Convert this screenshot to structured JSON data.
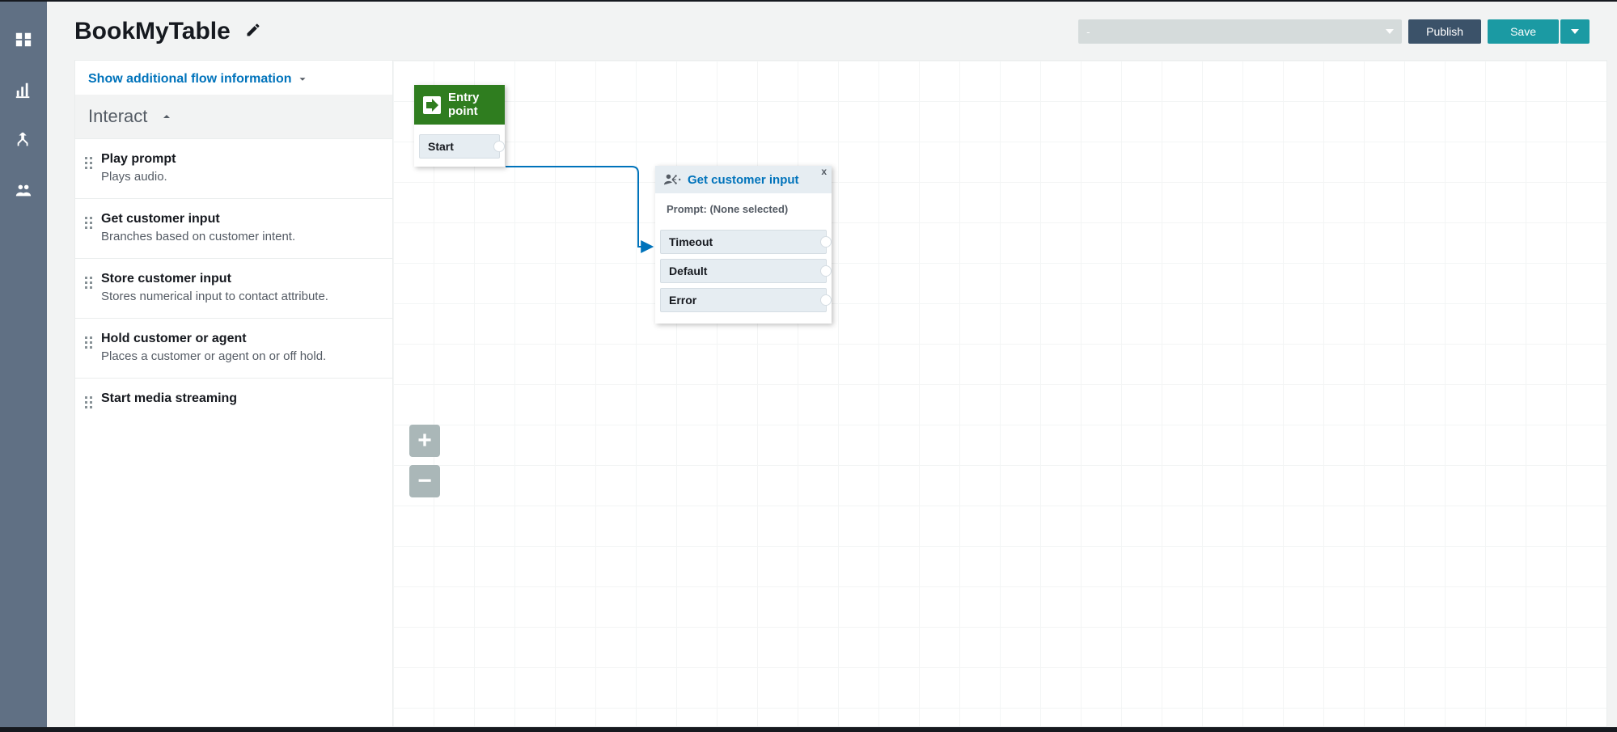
{
  "header": {
    "title": "BookMyTable",
    "select_placeholder": "-",
    "publish_label": "Publish",
    "save_label": "Save"
  },
  "sidebar": {
    "show_info_label": "Show additional flow information",
    "category_label": "Interact",
    "blocks": [
      {
        "title": "Play prompt",
        "desc": "Plays audio."
      },
      {
        "title": "Get customer input",
        "desc": "Branches based on customer intent."
      },
      {
        "title": "Store customer input",
        "desc": "Stores numerical input to contact attribute."
      },
      {
        "title": "Hold customer or agent",
        "desc": "Places a customer or agent on or off hold."
      },
      {
        "title": "Start media streaming",
        "desc": ""
      }
    ]
  },
  "canvas": {
    "entry": {
      "title1": "Entry",
      "title2": "point",
      "port": "Start"
    },
    "gci": {
      "title": "Get customer input",
      "prompt": "Prompt: (None selected)",
      "ports": [
        "Timeout",
        "Default",
        "Error"
      ]
    }
  }
}
